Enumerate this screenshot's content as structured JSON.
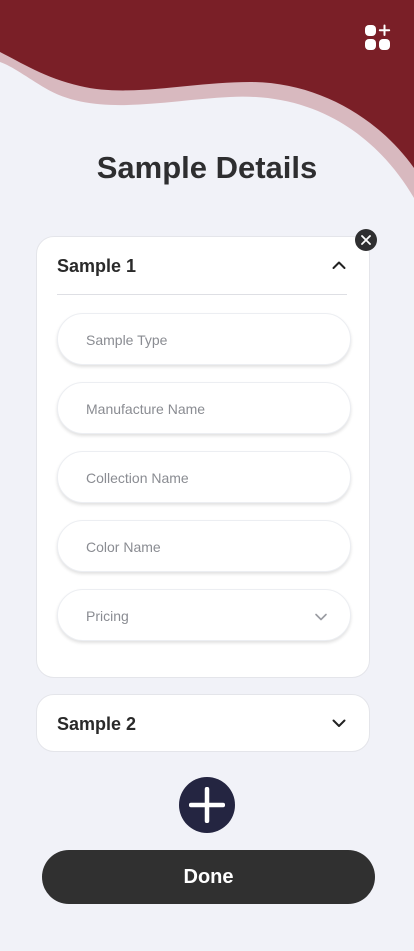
{
  "header": {
    "title": "Sample Details",
    "apps_icon": "apps-add-icon",
    "brand_color": "#7a1f27"
  },
  "samples": [
    {
      "title": "Sample 1",
      "expanded": true,
      "fields": {
        "sample_type": {
          "placeholder": "Sample Type",
          "value": ""
        },
        "manufacture_name": {
          "placeholder": "Manufacture Name",
          "value": ""
        },
        "collection_name": {
          "placeholder": "Collection Name",
          "value": ""
        },
        "color_name": {
          "placeholder": "Color Name",
          "value": ""
        },
        "pricing": {
          "placeholder": "Pricing",
          "value": ""
        }
      }
    },
    {
      "title": "Sample 2",
      "expanded": false
    }
  ],
  "actions": {
    "remove_icon": "close-icon",
    "add_icon": "plus-icon",
    "done_label": "Done"
  }
}
